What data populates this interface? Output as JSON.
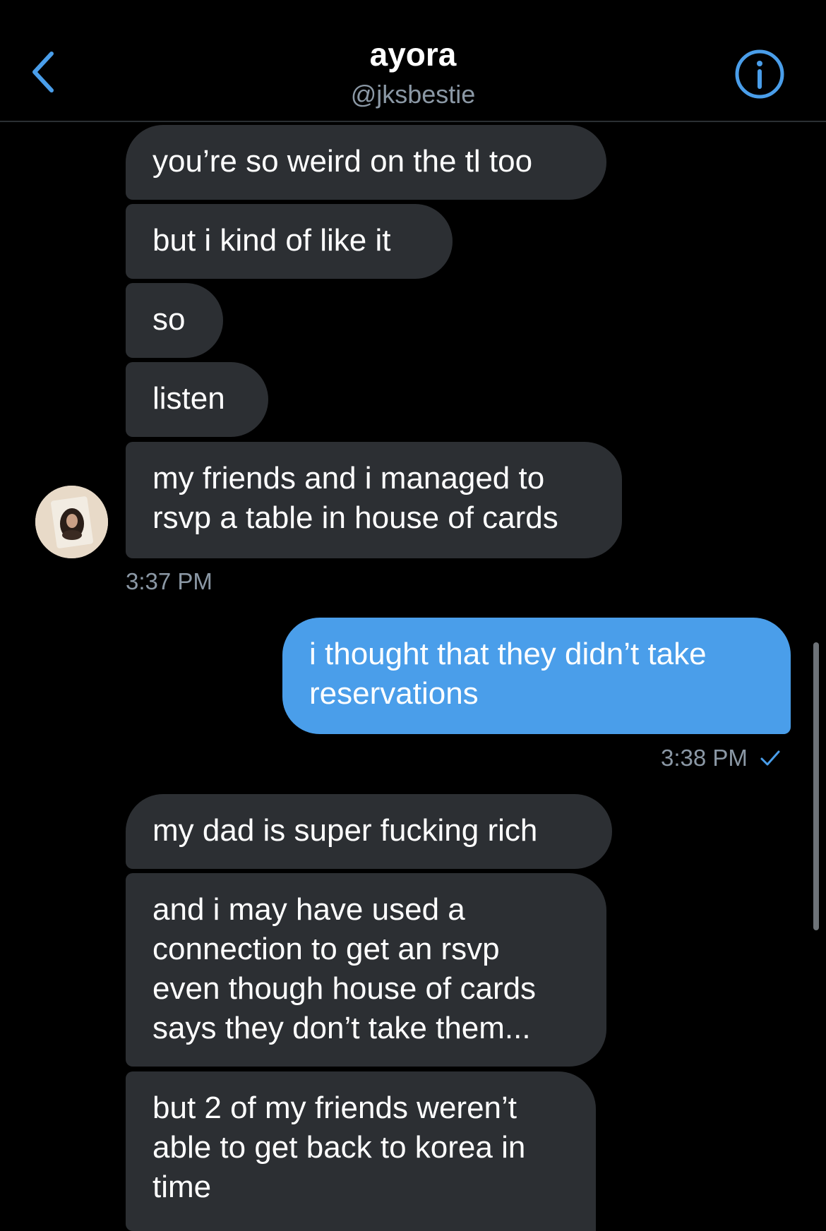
{
  "header": {
    "name": "ayora",
    "handle": "@jksbestie",
    "back_icon": "chevron-left-icon",
    "info_icon": "info-circle-icon",
    "accent_color": "#4a9eea"
  },
  "messages": {
    "m1": "you’re so weird on the tl too",
    "m2": "but i kind of like it",
    "m3": "so",
    "m4": "listen",
    "m5_l1": "my friends and i managed to",
    "m5_l2": "rsvp a table in house of cards",
    "time1": "3:37 PM",
    "s1_l1": "i thought that they didn’t take",
    "s1_l2": "reservations",
    "time2": "3:38 PM",
    "m6": "my dad is super fucking rich",
    "m7_l1": "and i may have used a",
    "m7_l2": "connection to get an rsvp",
    "m7_l3": "even though house of cards",
    "m7_l4": "says they don’t take them...",
    "m8_l1": "but 2 of my friends weren’t",
    "m8_l2": "able to get back to korea in",
    "m8_l3": "time"
  },
  "colors": {
    "received_bubble": "#2c2f33",
    "sent_bubble": "#4a9eea",
    "secondary_text": "#8b98a5"
  }
}
